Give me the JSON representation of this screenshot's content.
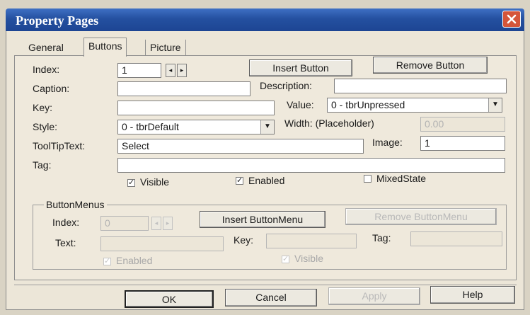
{
  "window": {
    "title": "Property Pages"
  },
  "tabs": [
    "General",
    "Buttons",
    "Picture"
  ],
  "fields": {
    "index_label": "Index:",
    "index_value": "1",
    "caption_label": "Caption:",
    "caption_value": "",
    "key_label": "Key:",
    "key_value": "",
    "style_label": "Style:",
    "style_value": "0 - tbrDefault",
    "tooltip_label": "ToolTipText:",
    "tooltip_value": "Select",
    "tag_label": "Tag:",
    "tag_value": "",
    "description_label": "Description:",
    "description_value": "",
    "value_label": "Value:",
    "value_value": "0 - tbrUnpressed",
    "width_label": "Width: (Placeholder)",
    "width_value": "0.00",
    "image_label": "Image:",
    "image_value": "1"
  },
  "buttons": {
    "insert": "Insert Button",
    "remove": "Remove Button"
  },
  "checks": [
    {
      "label": "Visible",
      "checked": true
    },
    {
      "label": "Enabled",
      "checked": true
    },
    {
      "label": "MixedState",
      "checked": false
    }
  ],
  "button_menus": {
    "group_label": "ButtonMenus",
    "index_label": "Index:",
    "index_value": "0",
    "insert": "Insert ButtonMenu",
    "remove": "Remove ButtonMenu",
    "text_label": "Text:",
    "key_label": "Key:",
    "tag_label": "Tag:",
    "enabled_label": "Enabled",
    "visible_label": "Visible"
  },
  "footer": {
    "ok": "OK",
    "cancel": "Cancel",
    "apply": "Apply",
    "help": "Help"
  }
}
